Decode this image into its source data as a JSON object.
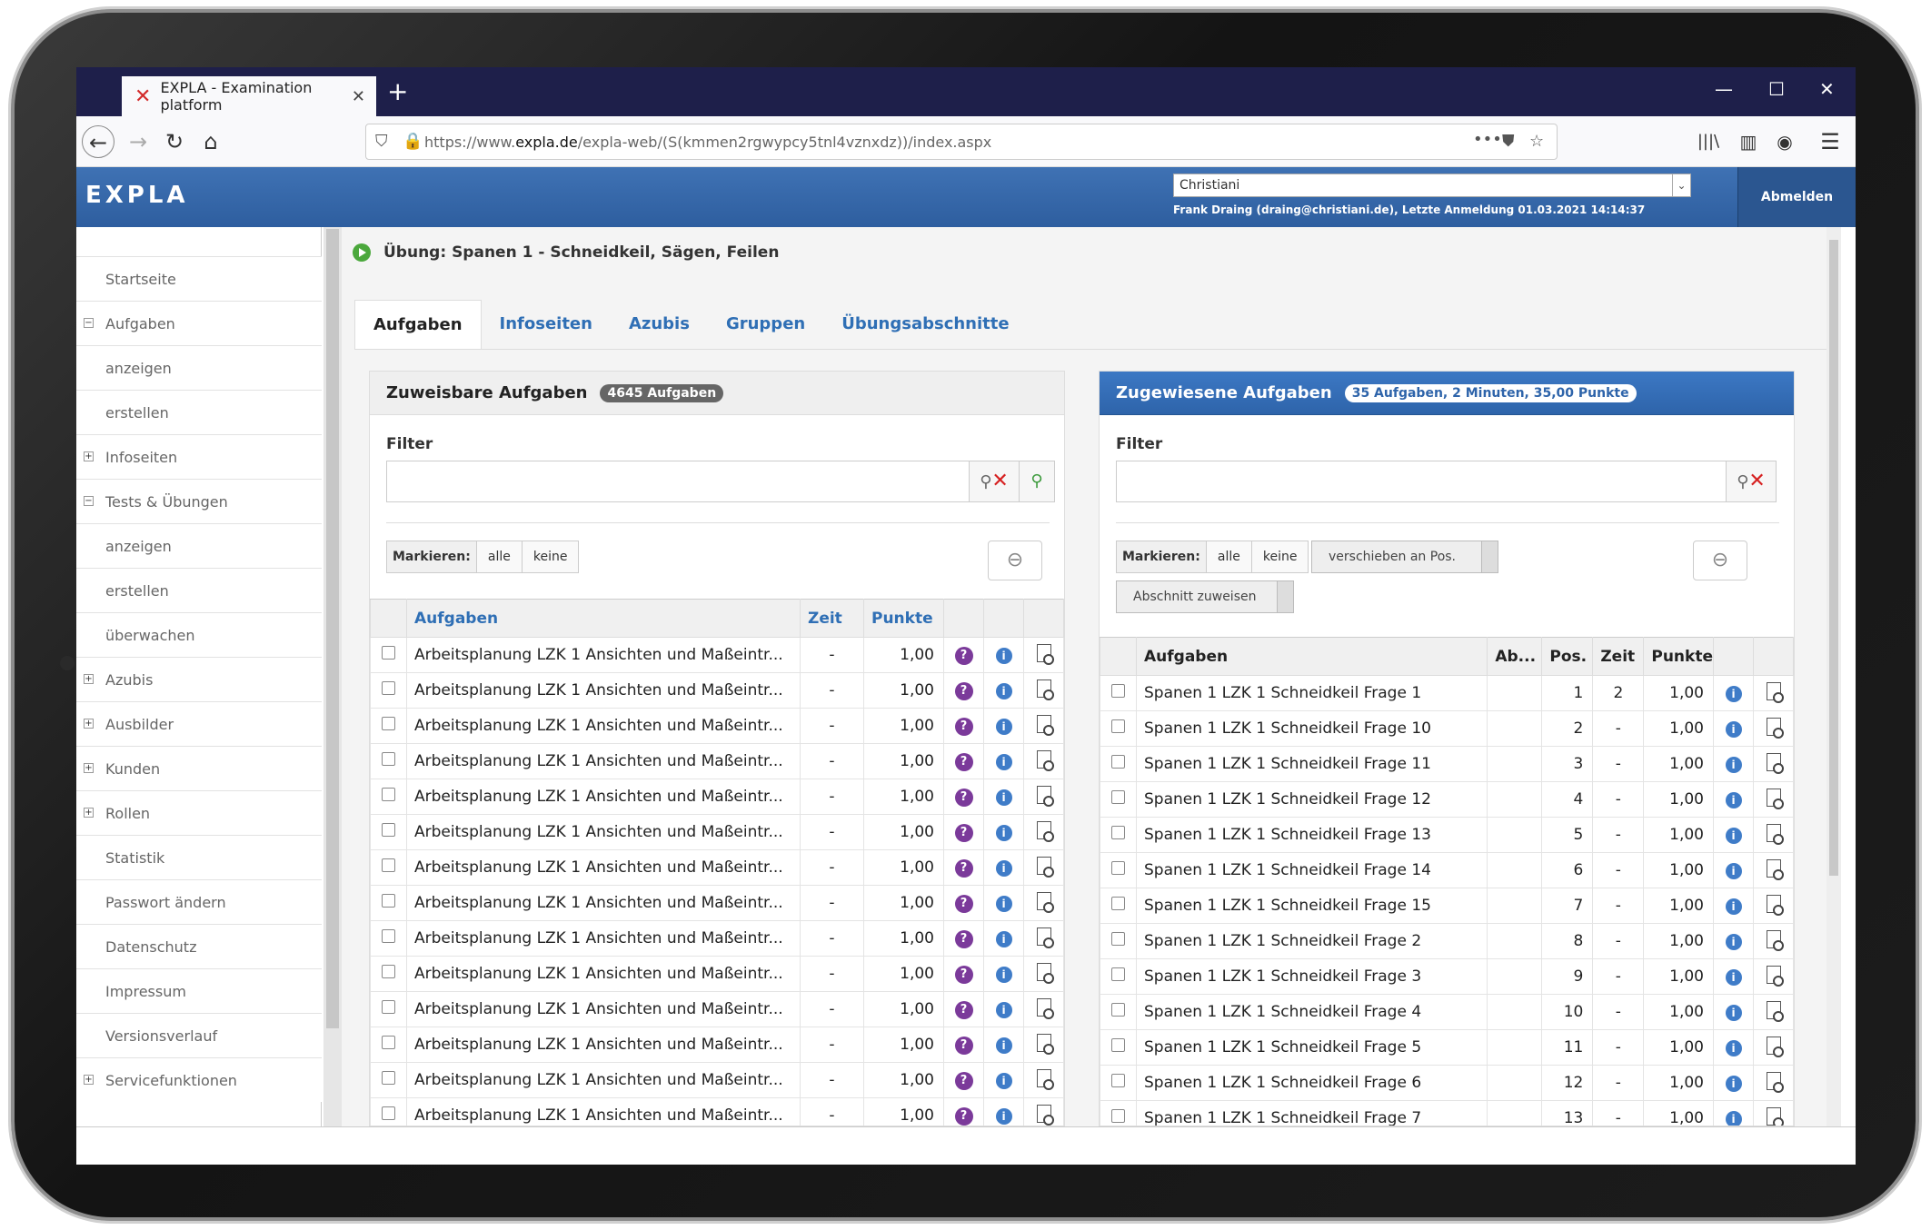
{
  "browser": {
    "tab_title": "EXPLA - Examination platform",
    "url_prefix": "https://www.",
    "url_domain": "expla.de",
    "url_path": "/expla-web/(S(kmmen2rgwypcy5tnl4vznxdz))/index.aspx"
  },
  "app": {
    "logo": "EXPLA",
    "user_select": "Christiani",
    "user_info": "Frank Draing (draing@christiani.de), Letzte Anmeldung 01.03.2021 14:14:37",
    "logout": "Abmelden"
  },
  "sidebar": {
    "items": [
      {
        "label": "Startseite",
        "pm": ""
      },
      {
        "label": "Aufgaben",
        "pm": "−"
      },
      {
        "label": "anzeigen",
        "pm": ""
      },
      {
        "label": "erstellen",
        "pm": ""
      },
      {
        "label": "Infoseiten",
        "pm": "+"
      },
      {
        "label": "Tests & Übungen",
        "pm": "−"
      },
      {
        "label": "anzeigen",
        "pm": ""
      },
      {
        "label": "erstellen",
        "pm": ""
      },
      {
        "label": "überwachen",
        "pm": ""
      },
      {
        "label": "Azubis",
        "pm": "+"
      },
      {
        "label": "Ausbilder",
        "pm": "+"
      },
      {
        "label": "Kunden",
        "pm": "+"
      },
      {
        "label": "Rollen",
        "pm": "+"
      },
      {
        "label": "Statistik",
        "pm": ""
      },
      {
        "label": "Passwort ändern",
        "pm": ""
      },
      {
        "label": "Datenschutz",
        "pm": ""
      },
      {
        "label": "Impressum",
        "pm": ""
      },
      {
        "label": "Versionsverlauf",
        "pm": ""
      },
      {
        "label": "Servicefunktionen",
        "pm": "+"
      }
    ]
  },
  "main": {
    "breadcrumb": "Übung: Spanen 1 - Schneidkeil, Sägen, Feilen",
    "tabs": [
      "Aufgaben",
      "Infoseiten",
      "Azubis",
      "Gruppen",
      "Übungsabschnitte"
    ]
  },
  "left": {
    "title": "Zuweisbare Aufgaben",
    "badge": "4645 Aufgaben",
    "filter_label": "Filter",
    "mark_label": "Markieren:",
    "mark_all": "alle",
    "mark_none": "keine",
    "cols": [
      "Aufgaben",
      "Zeit",
      "Punkte"
    ],
    "row_task": "Arbeitsplanung LZK 1 Ansichten und Maßeintr...",
    "row_time": "-",
    "row_points": "1,00",
    "row_count": 14
  },
  "right": {
    "title": "Zugewiesene Aufgaben",
    "badge": "35 Aufgaben, 2 Minuten, 35,00 Punkte",
    "filter_label": "Filter",
    "mark_label": "Markieren:",
    "mark_all": "alle",
    "mark_none": "keine",
    "move_label": "verschieben an Pos.",
    "section_label": "Abschnitt zuweisen",
    "cols": [
      "Aufgaben",
      "Ab...",
      "Pos.",
      "Zeit",
      "Punkte"
    ],
    "rows": [
      {
        "task": "Spanen 1 LZK 1 Schneidkeil Frage 1",
        "pos": "1",
        "time": "2",
        "points": "1,00"
      },
      {
        "task": "Spanen 1 LZK 1 Schneidkeil Frage 10",
        "pos": "2",
        "time": "-",
        "points": "1,00"
      },
      {
        "task": "Spanen 1 LZK 1 Schneidkeil Frage 11",
        "pos": "3",
        "time": "-",
        "points": "1,00"
      },
      {
        "task": "Spanen 1 LZK 1 Schneidkeil Frage 12",
        "pos": "4",
        "time": "-",
        "points": "1,00"
      },
      {
        "task": "Spanen 1 LZK 1 Schneidkeil Frage 13",
        "pos": "5",
        "time": "-",
        "points": "1,00"
      },
      {
        "task": "Spanen 1 LZK 1 Schneidkeil Frage 14",
        "pos": "6",
        "time": "-",
        "points": "1,00"
      },
      {
        "task": "Spanen 1 LZK 1 Schneidkeil Frage 15",
        "pos": "7",
        "time": "-",
        "points": "1,00"
      },
      {
        "task": "Spanen 1 LZK 1 Schneidkeil Frage 2",
        "pos": "8",
        "time": "-",
        "points": "1,00"
      },
      {
        "task": "Spanen 1 LZK 1 Schneidkeil Frage 3",
        "pos": "9",
        "time": "-",
        "points": "1,00"
      },
      {
        "task": "Spanen 1 LZK 1 Schneidkeil Frage 4",
        "pos": "10",
        "time": "-",
        "points": "1,00"
      },
      {
        "task": "Spanen 1 LZK 1 Schneidkeil Frage 5",
        "pos": "11",
        "time": "-",
        "points": "1,00"
      },
      {
        "task": "Spanen 1 LZK 1 Schneidkeil Frage 6",
        "pos": "12",
        "time": "-",
        "points": "1,00"
      },
      {
        "task": "Spanen 1 LZK 1 Schneidkeil Frage 7",
        "pos": "13",
        "time": "-",
        "points": "1,00"
      }
    ]
  },
  "colors": {
    "accent": "#2f6fb5",
    "header": "#3f72b4",
    "tabbar": "#1e1f4a"
  }
}
